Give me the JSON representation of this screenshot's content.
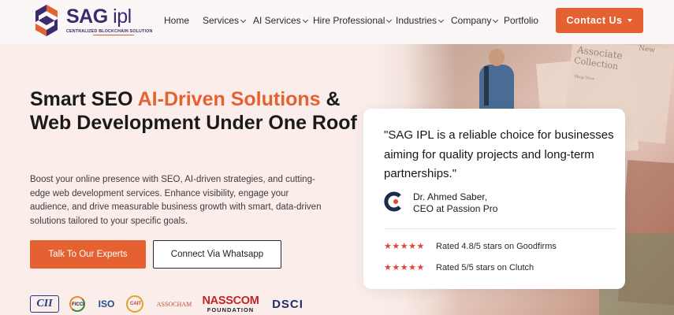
{
  "brand": {
    "name_main": "SAG",
    "name_suffix": "ipl",
    "tagline": "CENTRALIZED BLOCKCHAIN SOLUTION",
    "accent_color": "#e56132",
    "logo_colors": [
      "#e56132",
      "#3a2a70"
    ]
  },
  "nav": {
    "items": [
      {
        "label": "Home",
        "has_dropdown": false
      },
      {
        "label": "Services",
        "has_dropdown": true
      },
      {
        "label": "AI Services",
        "has_dropdown": true
      },
      {
        "label": "Hire Professional",
        "has_dropdown": true
      },
      {
        "label": "Industries",
        "has_dropdown": true
      },
      {
        "label": "Company",
        "has_dropdown": true
      },
      {
        "label": "Portfolio",
        "has_dropdown": false
      }
    ],
    "cta_label": "Contact Us"
  },
  "hero": {
    "headline_part1": "Smart SEO ",
    "headline_accent": "AI-Driven Solutions",
    "headline_part2": " & Web Development Under One Roof",
    "description": "Boost your online presence with SEO, AI-driven strategies, and cutting-edge web development services. Enhance visibility, engage your audience, and drive measurable business growth with smart, data-driven solutions tailored to your specific goals.",
    "primary_button": "Talk To Our Experts",
    "secondary_button": "Connect Via Whatsapp"
  },
  "partners": {
    "cii": "CII",
    "ficci": "FICCI",
    "iso": "ISO",
    "caii": "CAIT",
    "assocham": "ASSOCHAM",
    "nasscom_main": "NASSCOM",
    "nasscom_sub": "FOUNDATION",
    "dsci": "DSCI"
  },
  "testimonial": {
    "quote": "\"SAG IPL is a reliable choice for businesses aiming for quality projects and long-term partnerships.\"",
    "author_name": "Dr. Ahmed Saber,",
    "author_role": "CEO at Passion Pro",
    "ratings": [
      {
        "stars": 5,
        "text": "Rated 4.8/5 stars on Goodfirms"
      },
      {
        "stars": 5,
        "text": "Rated 5/5 stars on Clutch"
      }
    ],
    "star_color": "#e0443a"
  },
  "background_image": {
    "text_1": "Associate",
    "text_2": "Collection",
    "text_3": "New",
    "text_4": "Shop Now"
  }
}
